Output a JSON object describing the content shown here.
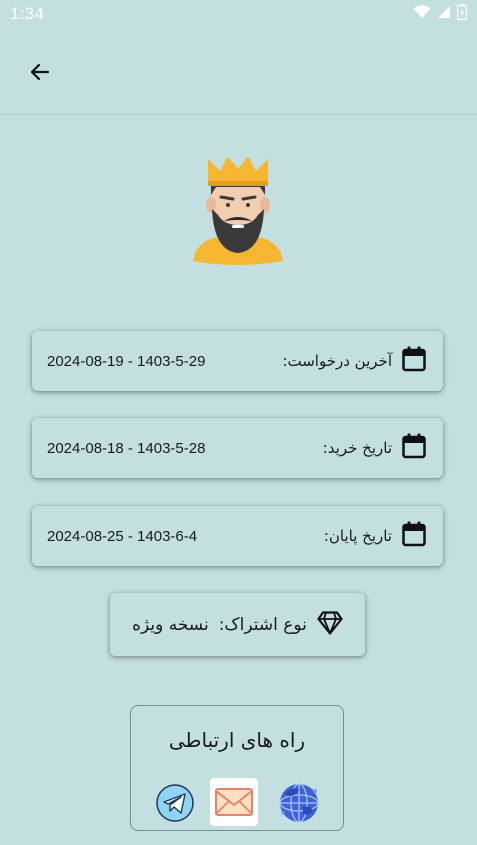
{
  "status_bar": {
    "time": "1:34"
  },
  "header": {
    "back_icon": "arrow-left-icon"
  },
  "avatar": {
    "icon": "king-avatar"
  },
  "info_cards": [
    {
      "label": "آخرین درخواست:",
      "value": "2024-08-19 - 1403-5-29",
      "icon": "calendar-icon"
    },
    {
      "label": "تاریخ خرید:",
      "value": "2024-08-18 - 1403-5-28",
      "icon": "calendar-icon"
    },
    {
      "label": "تاریخ پایان:",
      "value": "2024-08-25 - 1403-6-4",
      "icon": "calendar-icon"
    }
  ],
  "subscription": {
    "label": "نوع اشتراک:",
    "value": "نسخه ویژه",
    "icon": "diamond-icon"
  },
  "contact": {
    "title": "راه های ارتباطی",
    "icons": [
      "telegram-icon",
      "mail-icon",
      "globe-icon"
    ]
  },
  "colors": {
    "background": "#c3dfdf",
    "crown": "#f5b731",
    "shirt": "#f5b731"
  }
}
